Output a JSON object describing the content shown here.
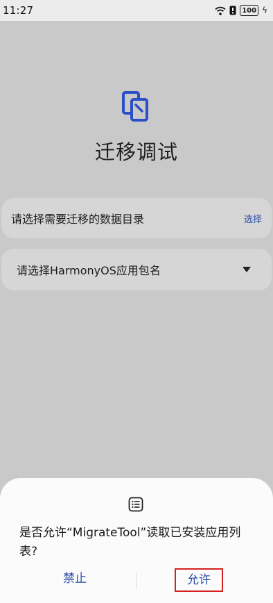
{
  "status_bar": {
    "time": "11:27",
    "battery": "100"
  },
  "app": {
    "title": "迁移调试"
  },
  "data_dir_row": {
    "label": "请选择需要迁移的数据目录",
    "action": "选择"
  },
  "package_row": {
    "label": "请选择HarmonyOS应用包名"
  },
  "permission_dialog": {
    "message": "是否允许“MigrateTool”读取已安装应用列表?",
    "deny_label": "禁止",
    "allow_label": "允许"
  },
  "colors": {
    "accent": "#2a4ea8",
    "highlight": "#d62020"
  }
}
